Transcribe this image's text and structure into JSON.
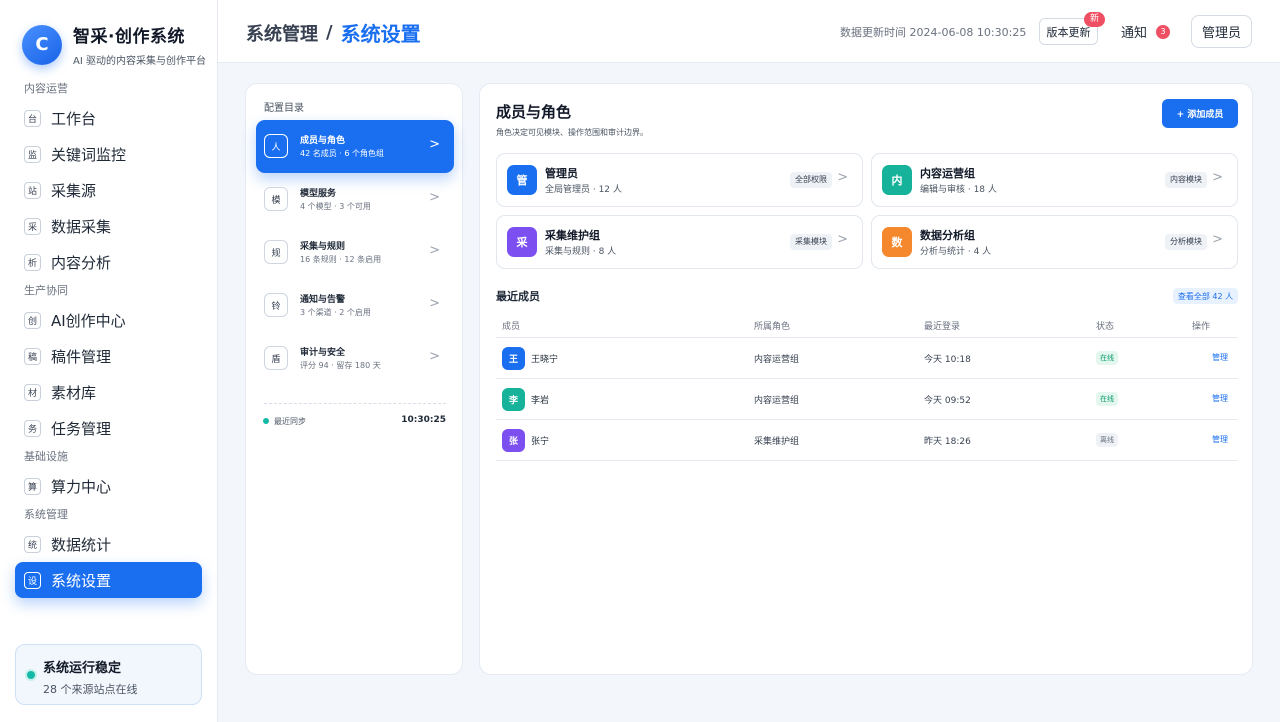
{
  "sidebar": {
    "logo_letter": "C",
    "brand_title": "智采·创作系统",
    "brand_subtitle": "AI 驱动的内容采集与创作平台",
    "sections": [
      {
        "title": "内容运营",
        "items": [
          {
            "icon": "台",
            "label": "工作台"
          },
          {
            "icon": "监",
            "label": "关键词监控"
          },
          {
            "icon": "站",
            "label": "采集源"
          },
          {
            "icon": "采",
            "label": "数据采集"
          },
          {
            "icon": "析",
            "label": "内容分析"
          }
        ]
      },
      {
        "title": "生产协同",
        "items": [
          {
            "icon": "创",
            "label": "AI创作中心"
          },
          {
            "icon": "稿",
            "label": "稿件管理"
          },
          {
            "icon": "材",
            "label": "素材库"
          },
          {
            "icon": "务",
            "label": "任务管理"
          }
        ]
      },
      {
        "title": "基础设施",
        "items": [
          {
            "icon": "算",
            "label": "算力中心"
          }
        ]
      },
      {
        "title": "系统管理",
        "items": [
          {
            "icon": "统",
            "label": "数据统计"
          },
          {
            "icon": "设",
            "label": "系统设置",
            "active": true
          }
        ]
      }
    ],
    "status": {
      "title": "系统运行稳定",
      "subtitle": "28 个来源站点在线"
    }
  },
  "header": {
    "breadcrumb_parent": "系统管理",
    "breadcrumb_sep": "/",
    "breadcrumb_current": "系统设置",
    "update_time": "数据更新时间 2024-06-08 10:30:25",
    "version_button": "版本更新",
    "version_badge": "新",
    "notice_label": "通知",
    "notice_count": "3",
    "admin_button": "管理员"
  },
  "config": {
    "title": "配置目录",
    "items": [
      {
        "icon": "人",
        "title": "成员与角色",
        "sub": "42 名成员 · 6 个角色组",
        "active": true
      },
      {
        "icon": "模",
        "title": "模型服务",
        "sub": "4 个模型 · 3 个可用"
      },
      {
        "icon": "规",
        "title": "采集与规则",
        "sub": "16 条规则 · 12 条启用"
      },
      {
        "icon": "铃",
        "title": "通知与告警",
        "sub": "3 个渠道 · 2 个启用"
      },
      {
        "icon": "盾",
        "title": "审计与安全",
        "sub": "评分 94 · 留存 180 天"
      }
    ],
    "chevron": ">",
    "sync_label": "最近同步",
    "sync_time": "10:30:25"
  },
  "main": {
    "title": "成员与角色",
    "subtitle": "角色决定可见模块、操作范围和审计边界。",
    "add_button": "+ 添加成员",
    "roles": [
      {
        "icon": "管",
        "name": "管理员",
        "desc": "全局管理员 · 12 人",
        "badge": "全部权限",
        "color": "#1a6ff0"
      },
      {
        "icon": "内",
        "name": "内容运营组",
        "desc": "编辑与审核 · 18 人",
        "badge": "内容模块",
        "color": "#16b39a"
      },
      {
        "icon": "采",
        "name": "采集维护组",
        "desc": "采集与规则 · 8 人",
        "badge": "采集模块",
        "color": "#7c4ff0"
      },
      {
        "icon": "数",
        "name": "数据分析组",
        "desc": "分析与统计 · 4 人",
        "badge": "分析模块",
        "color": "#f5872c"
      }
    ],
    "recent_title": "最近成员",
    "view_all": "查看全部 42 人",
    "table_headers": {
      "member": "成员",
      "role": "所属角色",
      "login": "最近登录",
      "status": "状态",
      "action": "操作"
    },
    "members": [
      {
        "avatar": "王",
        "name": "王晓宁",
        "role": "内容运营组",
        "login": "今天 10:18",
        "status": "在线",
        "online": true,
        "action": "管理",
        "color": "#1a6ff0"
      },
      {
        "avatar": "李",
        "name": "李岩",
        "role": "内容运营组",
        "login": "今天 09:52",
        "status": "在线",
        "online": true,
        "action": "管理",
        "color": "#16b39a"
      },
      {
        "avatar": "张",
        "name": "张宁",
        "role": "采集维护组",
        "login": "昨天 18:26",
        "status": "离线",
        "online": false,
        "action": "管理",
        "color": "#7c4ff0"
      }
    ]
  }
}
